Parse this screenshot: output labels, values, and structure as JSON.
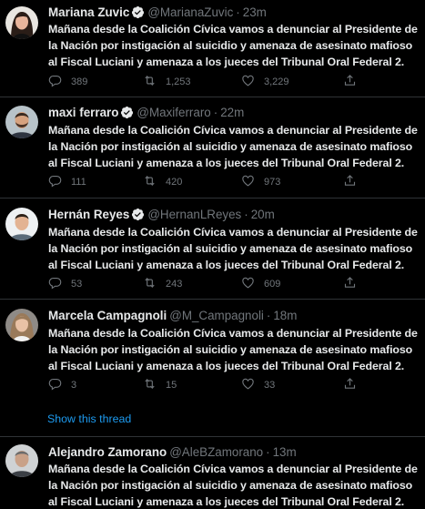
{
  "colors": {
    "background": "#000000",
    "text": "#e7e9ea",
    "muted": "#71767b",
    "accent": "#1d9bf0",
    "divider": "#2f3336"
  },
  "separator": "·",
  "tweets": [
    {
      "name": "Mariana Zuvic",
      "verified": true,
      "handle": "@MarianaZuvic",
      "time": "23m",
      "text": "Mañana desde la Coalición Cívica vamos a denunciar al Presidente de la Nación por instigación al suicidio y amenaza de asesinato mafioso al Fiscal Luciani y amenaza a los jueces del Tribunal Oral Federal 2.",
      "replies": "389",
      "retweets": "1,253",
      "likes": "3,229",
      "avatar_icon": "avatar-woman-dark-hair"
    },
    {
      "name": "maxi ferraro",
      "verified": true,
      "handle": "@Maxiferraro",
      "time": "22m",
      "text": "Mañana desde la Coalición Cívica vamos a denunciar al Presidente de la Nación por instigación al suicidio y amenaza de asesinato mafioso al Fiscal Luciani y amenaza a los jueces del Tribunal Oral Federal 2.",
      "replies": "111",
      "retweets": "420",
      "likes": "973",
      "avatar_icon": "avatar-man-beard"
    },
    {
      "name": "Hernán Reyes",
      "verified": true,
      "handle": "@HernanLReyes",
      "time": "20m",
      "text": "Mañana desde la Coalición Cívica vamos a denunciar al Presidente de la Nación por instigación al suicidio y amenaza de asesinato mafioso al Fiscal Luciani y amenaza a los jueces del Tribunal Oral Federal 2.",
      "replies": "53",
      "retweets": "243",
      "likes": "609",
      "avatar_icon": "avatar-man-light-background"
    },
    {
      "name": "Marcela Campagnoli",
      "verified": false,
      "handle": "@M_Campagnoli",
      "time": "18m",
      "text": "Mañana desde la Coalición Cívica vamos a denunciar al Presidente de la Nación por instigación al suicidio y amenaza de asesinato mafioso al Fiscal Luciani y amenaza a los jueces del Tribunal Oral Federal 2.",
      "replies": "3",
      "retweets": "15",
      "likes": "33",
      "avatar_icon": "avatar-woman-light-hair"
    },
    {
      "name": "Alejandro Zamorano",
      "verified": false,
      "handle": "@AleBZamorano",
      "time": "13m",
      "text": "Mañana desde la Coalición Cívica vamos a denunciar al Presidente de la Nación por instigación al suicidio y amenaza de asesinato mafioso al Fiscal Luciani y amenaza a los jueces del Tribunal Oral Federal 2.",
      "replies": "",
      "retweets": "",
      "likes": "",
      "avatar_icon": "avatar-man-grey"
    }
  ],
  "show_thread_label": "Show this thread"
}
